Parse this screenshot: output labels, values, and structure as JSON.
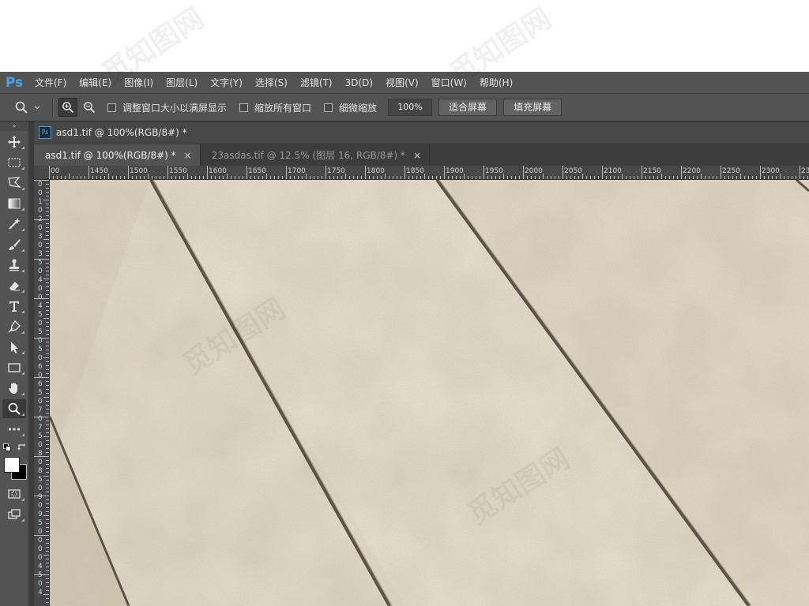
{
  "app": {
    "logo": "Ps"
  },
  "menu": [
    "文件(F)",
    "编辑(E)",
    "图像(I)",
    "图层(L)",
    "文字(Y)",
    "选择(S)",
    "滤镜(T)",
    "3D(D)",
    "视图(V)",
    "窗口(W)",
    "帮助(H)"
  ],
  "options": {
    "check_resize": "调整窗口大小以满屏显示",
    "check_zoom_all": "缩放所有窗口",
    "check_scrubby": "细微缩放",
    "zoom_value": "100%",
    "fit_screen": "适合屏幕",
    "fill_screen": "填充屏幕"
  },
  "document": {
    "strip_title": "asd1.tif @ 100%(RGB/8#) *",
    "tabs": [
      {
        "label": "asd1.tif @ 100%(RGB/8#) *",
        "close": "×"
      },
      {
        "label": "23asdas.tif @ 12.5% (图层 16, RGB/8#) *",
        "close": "×"
      }
    ]
  },
  "ruler": {
    "top_labels": [
      "00",
      "1450",
      "1500",
      "1550",
      "1600",
      "1650",
      "1700",
      "1750",
      "1800",
      "1850",
      "1900",
      "1950",
      "2000",
      "2050",
      "2100",
      "2150",
      "2200",
      "2250",
      "2300",
      "2350"
    ],
    "left_labels": [
      "0",
      "0",
      "1",
      "0",
      "2",
      "0",
      "3",
      "0",
      "3",
      "5",
      "0",
      "4",
      "0",
      "0",
      "4",
      "5",
      "0",
      "5",
      "0",
      "5",
      "0",
      "6",
      "0",
      "6",
      "5",
      "0",
      "7",
      "0",
      "7",
      "5",
      "0",
      "8",
      "0",
      "8",
      "5",
      "0",
      "9",
      "0",
      "9",
      "5",
      "0",
      "0",
      "0",
      "0",
      "4",
      "5",
      "0",
      "4"
    ]
  },
  "colors": {
    "accent": "#4aa3e6",
    "chrome": "#535353",
    "canvas": "#ece4d3"
  },
  "watermark": "觅知图网"
}
